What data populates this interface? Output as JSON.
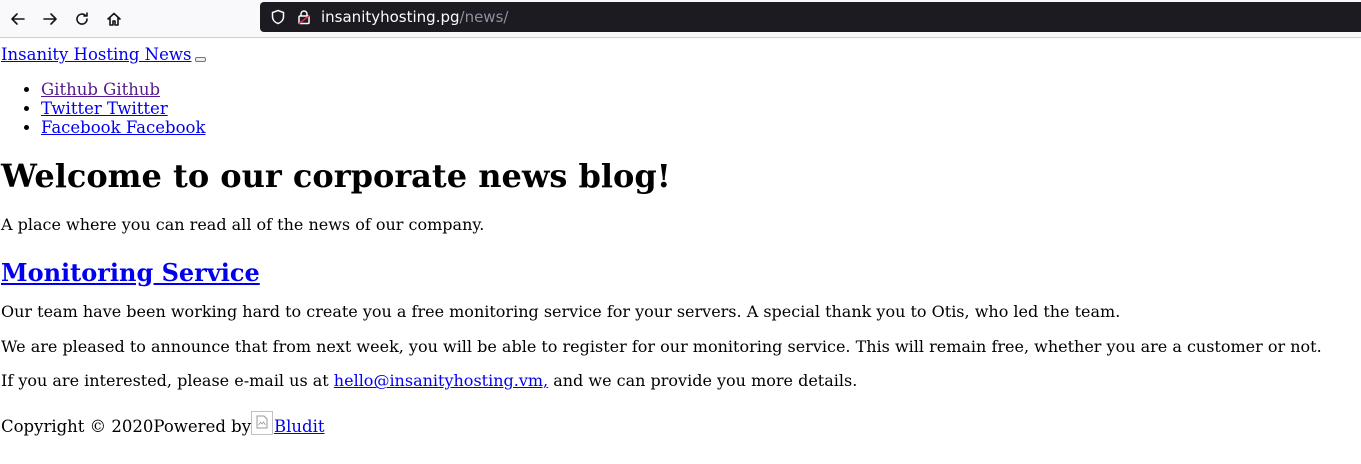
{
  "browser": {
    "url_host": "insanityhosting.pg",
    "url_path": "/news/"
  },
  "nav": {
    "brand": "Insanity Hosting News",
    "social": [
      {
        "label": "Github Github"
      },
      {
        "label": "Twitter Twitter"
      },
      {
        "label": "Facebook Facebook"
      }
    ]
  },
  "hero": {
    "title": "Welcome to our corporate news blog!",
    "subtitle": "A place where you can read all of the news of our company."
  },
  "post": {
    "title": "Monitoring Service",
    "paragraph1": "Our team have been working hard to create you a free monitoring service for your servers. A special thank you to Otis, who led the team.",
    "paragraph2": "We are pleased to announce that from next week, you will be able to register for our monitoring service. This will remain free, whether you are a customer or not.",
    "paragraph3_before": "If you are interested, please e-mail us at ",
    "email_link": "hello@insanityhosting.vm,",
    "paragraph3_after": " and we can provide you more details."
  },
  "footer": {
    "copyright": "Copyright © 2020",
    "powered_by": "Powered by",
    "bludit_link": "Bludit"
  },
  "colors": {
    "link": "#0000ee",
    "visited_link": "#551a8b",
    "urlbar_bg": "#1c1b22"
  }
}
